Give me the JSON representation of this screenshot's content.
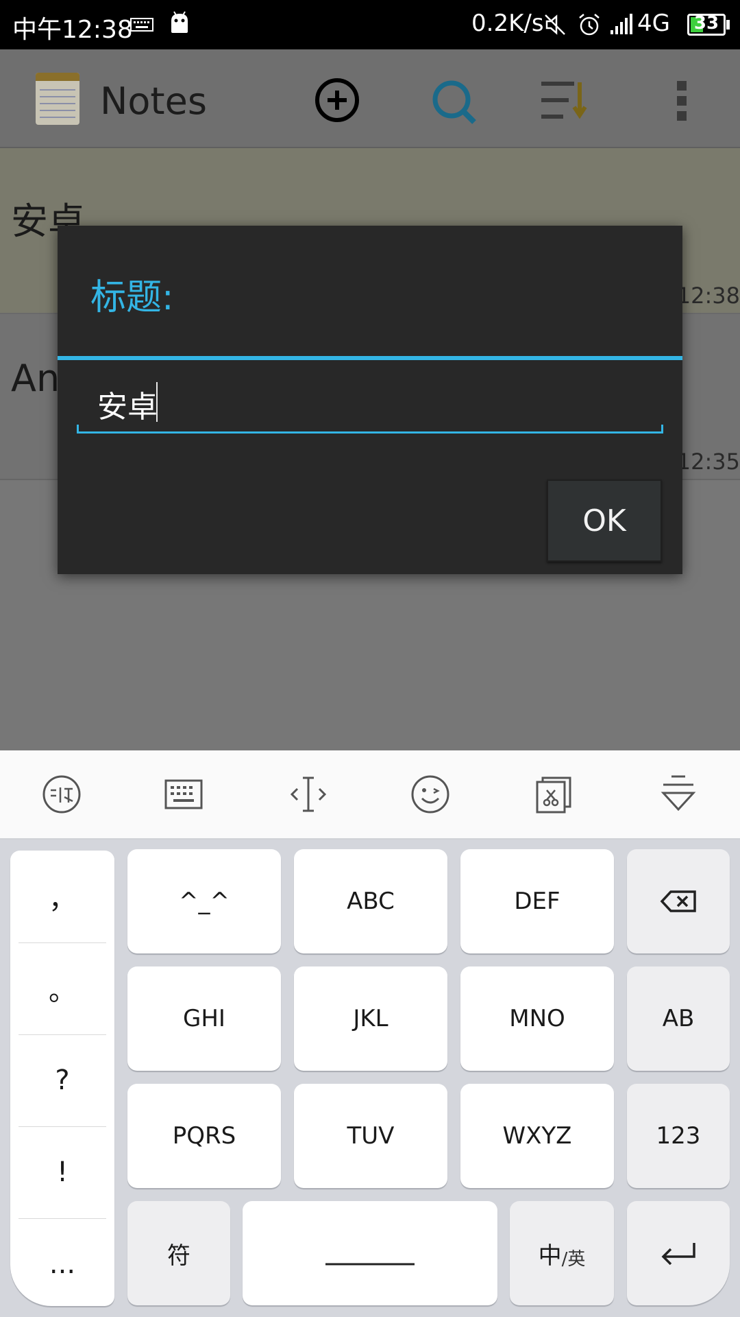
{
  "status_bar": {
    "time": "中午12:38",
    "speed": "0.2K/s",
    "network": "4G",
    "battery": "33"
  },
  "action_bar": {
    "title": "Notes",
    "icons": [
      "notes-app-icon",
      "add-note-icon",
      "search-icon",
      "sort-icon",
      "overflow-menu-icon"
    ]
  },
  "notes": [
    {
      "title": "安卓",
      "time": "12:38"
    },
    {
      "title": "An",
      "time": "12:35"
    }
  ],
  "dialog": {
    "title": "标题:",
    "input_value": "安卓",
    "ok_label": "OK"
  },
  "keyboard": {
    "toolbar": [
      "ifly-logo-icon",
      "keyboard-icon",
      "cursor-move-icon",
      "emoji-icon",
      "clipboard-icon",
      "hide-keyboard-icon"
    ],
    "punctuation": [
      "，",
      "。",
      "?",
      "!",
      "..."
    ],
    "rows": [
      [
        "^_^",
        "ABC",
        "DEF"
      ],
      [
        "GHI",
        "JKL",
        "MNO"
      ],
      [
        "PQRS",
        "TUV",
        "WXYZ"
      ]
    ],
    "side_keys": [
      "AB",
      "123"
    ],
    "bottom": {
      "symbol": "符",
      "lang_main": "中",
      "lang_sub": "/英"
    }
  },
  "colors": {
    "accent": "#33b5e5",
    "dialog_bg": "#282828"
  }
}
